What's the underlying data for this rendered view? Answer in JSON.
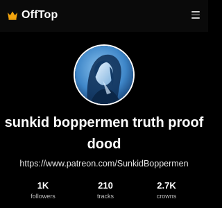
{
  "header": {
    "brand": "OffTop",
    "crown_color": "#f2a40d",
    "menu_icon": "hamburger-menu-icon"
  },
  "profile": {
    "avatar_caption": "Sunkid boppermen truth proof dood",
    "name": "sunkid boppermen truth proof dood",
    "link": "https://www.patreon.com/SunkidBoppermen"
  },
  "stats": [
    {
      "value": "1K",
      "label": "followers"
    },
    {
      "value": "210",
      "label": "tracks"
    },
    {
      "value": "2.7K",
      "label": "crowns"
    }
  ]
}
